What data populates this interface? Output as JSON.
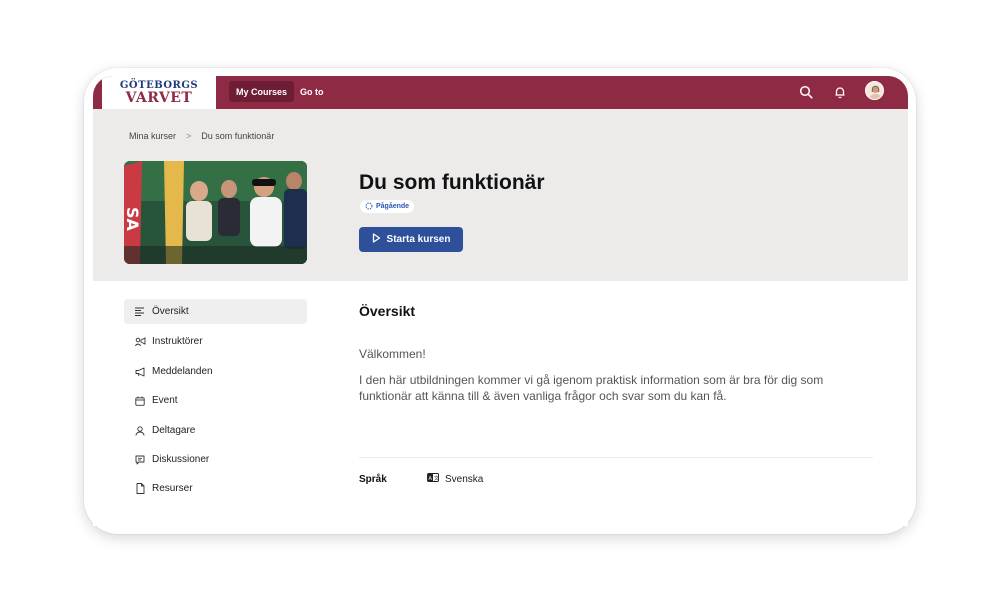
{
  "brand": {
    "logo_top": "GÖTEBORGS",
    "logo_bottom": "VARVET",
    "accent": "#8f2a45",
    "primary": "#2e4f9a"
  },
  "topbar": {
    "nav": [
      {
        "label": "My Courses",
        "active": true
      },
      {
        "label": "Go to",
        "active": false
      }
    ],
    "icons": [
      "search-icon",
      "bell-icon",
      "avatar"
    ]
  },
  "breadcrumb": {
    "items": [
      "Mina kurser",
      "Du som funktionär"
    ],
    "separator": ">"
  },
  "course": {
    "title": "Du som funktionär",
    "status": "Pågående",
    "start_label": "Starta kursen"
  },
  "sidebar": {
    "items": [
      {
        "label": "Översikt",
        "icon": "list-icon",
        "active": true
      },
      {
        "label": "Instruktörer",
        "icon": "megaphone-person-icon",
        "active": false
      },
      {
        "label": "Meddelanden",
        "icon": "megaphone-icon",
        "active": false
      },
      {
        "label": "Event",
        "icon": "calendar-icon",
        "active": false
      },
      {
        "label": "Deltagare",
        "icon": "user-icon",
        "active": false
      },
      {
        "label": "Diskussioner",
        "icon": "chat-icon",
        "active": false
      },
      {
        "label": "Resurser",
        "icon": "file-icon",
        "active": false
      }
    ]
  },
  "overview": {
    "heading": "Översikt",
    "welcome": "Välkommen!",
    "body": "I den här utbildningen kommer vi gå igenom praktisk information som är bra för dig som funktionär att känna till & även vanliga frågor och svar som du kan få.",
    "language_label": "Språk",
    "language_value": "Svenska"
  }
}
